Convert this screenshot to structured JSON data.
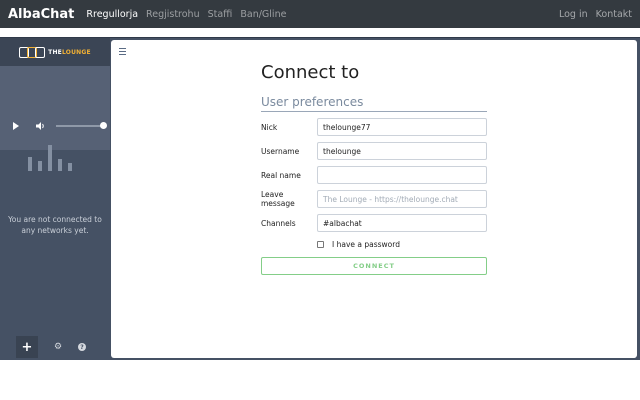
{
  "navbar": {
    "brand": "AlbaChat",
    "links": [
      "Rregullorja",
      "Regjistrohu",
      "Staffi",
      "Ban/Gline"
    ],
    "right_links": [
      "Log in",
      "Kontakt"
    ]
  },
  "sidebar": {
    "logo_text_prefix": "THE",
    "logo_text": "LOUNGE",
    "player": {
      "play_icon": "play-icon",
      "volume_icon": "volume-icon",
      "volume_level": 1.0
    },
    "status_text": "You are not connected to any networks yet.",
    "footer": {
      "add_icon": "plus-icon",
      "add_label": "+",
      "settings_icon": "gear-icon",
      "help_icon": "help-icon",
      "help_label": "?"
    }
  },
  "main": {
    "menu_icon": "hamburger-icon",
    "title": "Connect to",
    "section_title": "User preferences",
    "fields": [
      {
        "label": "Nick",
        "value": "thelounge77",
        "placeholder": ""
      },
      {
        "label": "Username",
        "value": "thelounge",
        "placeholder": ""
      },
      {
        "label": "Real name",
        "value": "",
        "placeholder": ""
      },
      {
        "label": "Leave message",
        "value": "",
        "placeholder": "The Lounge - https://thelounge.chat"
      },
      {
        "label": "Channels",
        "value": "#albachat",
        "placeholder": ""
      }
    ],
    "password_checkbox_label": "I have a password",
    "password_checked": false,
    "connect_button": "CONNECT"
  },
  "colors": {
    "navbar_bg": "#343a40",
    "sidebar_bg": "#455164",
    "accent_orange": "#f2b134",
    "connect_green": "#84ce88"
  }
}
